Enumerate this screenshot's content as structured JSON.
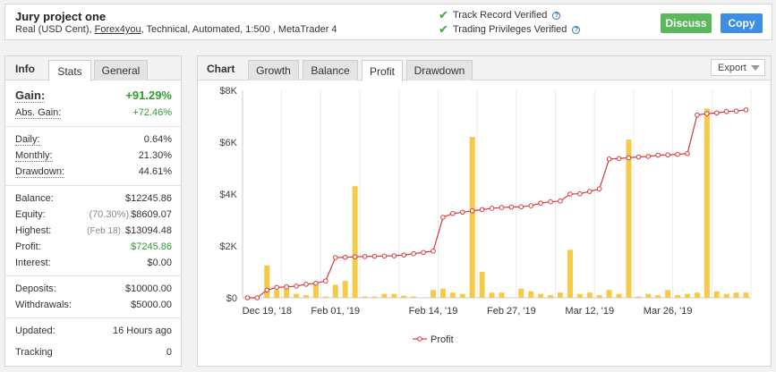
{
  "header": {
    "title": "Jury project one",
    "sub_prefix": "Real (USD Cent),",
    "broker": "Forex4you",
    "sub_suffix": ", Technical, Automated, 1:500 , MetaTrader 4",
    "track_record": "Track Record Verified",
    "trading_privileges": "Trading Privileges Verified",
    "discuss_label": "Discuss",
    "copy_label": "Copy",
    "help_glyph": "?",
    "icons": [
      "check-icon",
      "help-icon"
    ]
  },
  "left_tabs": {
    "title": "Info",
    "tabs": [
      "Stats",
      "General"
    ],
    "active": "Stats"
  },
  "stats": {
    "gain_label": "Gain:",
    "gain_value": "+91.29%",
    "abs_gain_label": "Abs. Gain:",
    "abs_gain_value": "+72.46%",
    "daily_label": "Daily:",
    "daily_value": "0.64%",
    "monthly_label": "Monthly:",
    "monthly_value": "21.30%",
    "drawdown_label": "Drawdown:",
    "drawdown_value": "44.61%",
    "balance_label": "Balance:",
    "balance_value": "$12245.86",
    "equity_label": "Equity:",
    "equity_pct": "(70.30%)",
    "equity_value": "$8609.07",
    "highest_label": "Highest:",
    "highest_date": "(Feb 18)",
    "highest_value": "$13094.48",
    "profit_label": "Profit:",
    "profit_value": "$7245.86",
    "interest_label": "Interest:",
    "interest_value": "$0.00",
    "deposits_label": "Deposits:",
    "deposits_value": "$10000.00",
    "withdrawals_label": "Withdrawals:",
    "withdrawals_value": "$5000.00",
    "updated_label": "Updated:",
    "updated_value": "16 Hours ago",
    "tracking_label": "Tracking",
    "tracking_value": "0"
  },
  "chart_tabs": {
    "title": "Chart",
    "tabs": [
      "Growth",
      "Balance",
      "Profit",
      "Drawdown"
    ],
    "active": "Profit",
    "export_label": "Export"
  },
  "colors": {
    "bar": "#f7c948",
    "line": "#d9383a",
    "green": "#2e9b2e",
    "discuss": "#5cb85c",
    "copy": "#3d8fe4"
  },
  "chart_data": {
    "type": "bar+line",
    "ylim": [
      0,
      8000
    ],
    "y_ticks": [
      "$0",
      "$2K",
      "$4K",
      "$6K",
      "$8K"
    ],
    "y_tick_values": [
      0,
      2000,
      4000,
      6000,
      8000
    ],
    "x_ticks": [
      "Dec 19, '18",
      "Feb 01, '19",
      "Feb 14, '19",
      "Feb 27, '19",
      "Mar 12, '19",
      "Mar 26, '19"
    ],
    "x_tick_index": [
      2,
      9,
      19,
      27,
      35,
      43
    ],
    "legend": "Profit",
    "bars": [
      0,
      0,
      1250,
      300,
      500,
      150,
      100,
      500,
      50,
      500,
      650,
      4300,
      50,
      50,
      150,
      150,
      80,
      50,
      0,
      300,
      350,
      200,
      150,
      6200,
      1000,
      200,
      200,
      0,
      350,
      250,
      150,
      100,
      200,
      1850,
      150,
      200,
      100,
      300,
      150,
      6100,
      50,
      150,
      100,
      300,
      100,
      150,
      200,
      7300,
      250,
      150,
      200,
      200
    ],
    "profit_line": [
      0,
      0,
      300,
      400,
      420,
      450,
      520,
      560,
      650,
      1550,
      1560,
      1580,
      1590,
      1600,
      1610,
      1620,
      1650,
      1700,
      1750,
      1800,
      3100,
      3250,
      3300,
      3350,
      3400,
      3450,
      3480,
      3500,
      3510,
      3550,
      3650,
      3700,
      3730,
      4000,
      4010,
      4100,
      4200,
      5350,
      5370,
      5400,
      5430,
      5450,
      5500,
      5510,
      5530,
      5560,
      7050,
      7100,
      7130,
      7180,
      7200,
      7245
    ]
  }
}
